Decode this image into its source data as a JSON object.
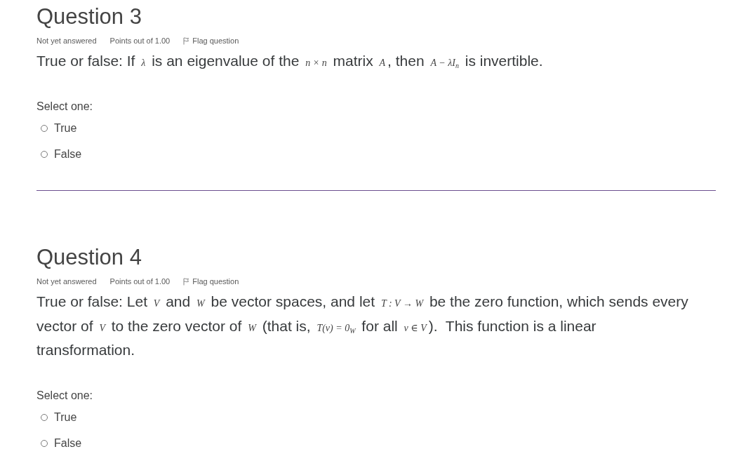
{
  "questions": [
    {
      "title": "Question 3",
      "meta": {
        "status": "Not yet answered",
        "points": "Points out of 1.00",
        "flag": "Flag question"
      },
      "text": [
        {
          "kind": "text",
          "text": "True or false: If "
        },
        {
          "kind": "math",
          "text": "λ"
        },
        {
          "kind": "text",
          "text": " is an eigenvalue of the "
        },
        {
          "kind": "math",
          "text": "n × n"
        },
        {
          "kind": "text",
          "text": " matrix "
        },
        {
          "kind": "math",
          "text": "A"
        },
        {
          "kind": "text",
          "text": ", then "
        },
        {
          "kind": "math",
          "text": "A − λI$_{n}$"
        },
        {
          "kind": "text",
          "text": " is invertible."
        }
      ],
      "prompt": "Select one:",
      "options": [
        {
          "label": "True",
          "selected": false
        },
        {
          "label": "False",
          "selected": false
        }
      ]
    },
    {
      "title": "Question 4",
      "meta": {
        "status": "Not yet answered",
        "points": "Points out of 1.00",
        "flag": "Flag question"
      },
      "text": [
        {
          "kind": "text",
          "text": "True or false: Let "
        },
        {
          "kind": "math",
          "text": "V"
        },
        {
          "kind": "text",
          "text": " and "
        },
        {
          "kind": "math",
          "text": "W"
        },
        {
          "kind": "text",
          "text": " be vector spaces, and let "
        },
        {
          "kind": "math",
          "text": "T : V → W"
        },
        {
          "kind": "text",
          "text": " be the zero function, which sends every vector of "
        },
        {
          "kind": "math",
          "text": "V"
        },
        {
          "kind": "text",
          "text": " to the zero vector of "
        },
        {
          "kind": "math",
          "text": "W"
        },
        {
          "kind": "text",
          "text": " (that is, "
        },
        {
          "kind": "math",
          "text": "T(v) = 0$_{W}$"
        },
        {
          "kind": "text",
          "text": " for all "
        },
        {
          "kind": "math",
          "text": "v ∈ V"
        },
        {
          "kind": "text",
          "text": ").  This function is a linear transformation."
        }
      ],
      "prompt": "Select one:",
      "options": [
        {
          "label": "True",
          "selected": false
        },
        {
          "label": "False",
          "selected": false
        }
      ]
    }
  ]
}
